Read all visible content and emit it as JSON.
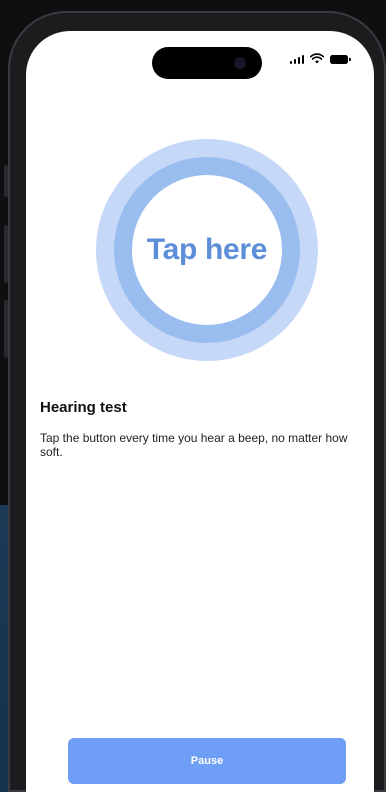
{
  "app": {
    "tap_button_label": "Tap here",
    "title": "Hearing test",
    "description": "Tap the button every time you hear a beep, no matter how soft.",
    "pause_label": "Pause"
  },
  "status_bar": {
    "icons": [
      "cellular-signal-icon",
      "wifi-icon",
      "battery-icon"
    ]
  },
  "colors": {
    "accent": "#6f9ef6",
    "tap_text": "#5d8fd8",
    "outer_ring": "#c6d8f8",
    "inner_ring": "#9abdf0"
  }
}
